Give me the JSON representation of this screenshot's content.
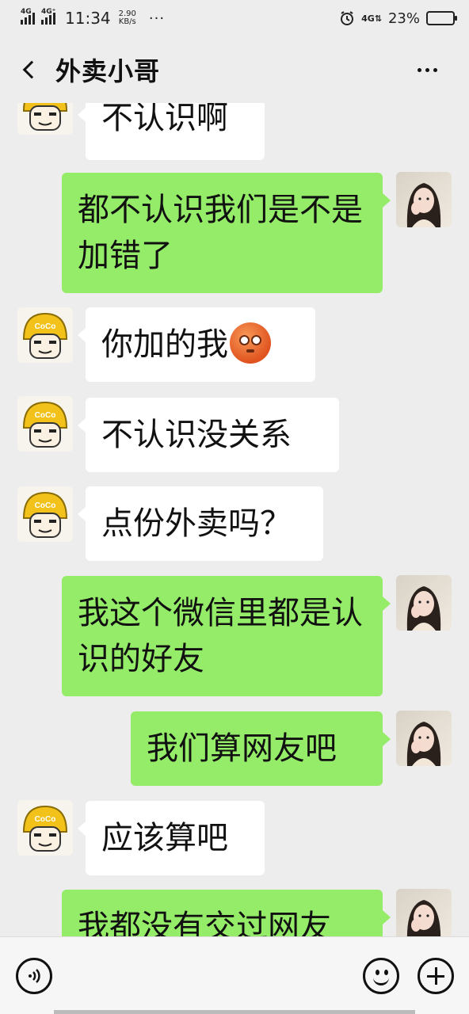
{
  "status_bar": {
    "sig1": "4G",
    "sig2": "4G⁺",
    "time": "11:34",
    "speed_value": "2.90",
    "speed_unit": "KB/s",
    "dots": "···",
    "right_4g": "4G⇅",
    "battery": "23%",
    "battery_level": 0.23
  },
  "header": {
    "title": "外卖小哥",
    "more_icon": "ellipsis-icon"
  },
  "messages": [
    {
      "side": "in",
      "text": "不认识啊"
    },
    {
      "side": "out",
      "text": "都不认识我们是不是加错了"
    },
    {
      "side": "in",
      "text": "你加的我",
      "emoji": "flushed-face"
    },
    {
      "side": "in",
      "text": "不认识没关系"
    },
    {
      "side": "in",
      "text": "点份外卖吗？"
    },
    {
      "side": "out",
      "text": "我这个微信里都是认识的好友"
    },
    {
      "side": "out",
      "text": "我们算网友吧"
    },
    {
      "side": "in",
      "text": "应该算吧"
    },
    {
      "side": "out",
      "text": "我都没有交过网友"
    }
  ],
  "avatar_badge": "CoCo",
  "input_bar": {
    "voice_icon": "voice-icon",
    "emoji_icon": "emoji-icon",
    "plus_icon": "plus-icon"
  }
}
